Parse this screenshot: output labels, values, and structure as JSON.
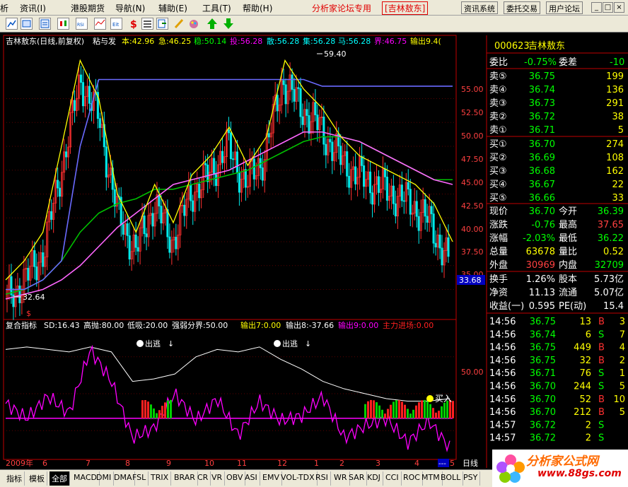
{
  "menu": {
    "items": [
      "析",
      "资讯(I)",
      "港股期货",
      "导航(N)",
      "辅助(E)",
      "工具(T)",
      "帮助(H)"
    ],
    "title": "分析家论坛专用",
    "stock_tag": "[吉林敖东]",
    "buttons": [
      "资讯系统",
      "委托交易",
      "用户论坛"
    ],
    "window_buttons": [
      "_",
      "□",
      "×"
    ]
  },
  "chart_header": {
    "name": "吉林敖东(日线,前复权)",
    "indicator": "粘与发",
    "items": [
      {
        "label": "本:42.96",
        "color": "#ffff00"
      },
      {
        "label": "急:46.25",
        "color": "#ffff00"
      },
      {
        "label": "稳:50.14",
        "color": "#00ff00"
      },
      {
        "label": "投:56.28",
        "color": "#ff00ff"
      },
      {
        "label": "散:56.28",
        "color": "#00ffff"
      },
      {
        "label": "集:56.28",
        "color": "#00ffff"
      },
      {
        "label": "马:56.28",
        "color": "#00ffff"
      },
      {
        "label": "界:46.75",
        "color": "#ff00ff"
      },
      {
        "label": "输出9.4(",
        "color": "#ffff00"
      }
    ]
  },
  "price_axis": {
    "ticks": [
      "55.00",
      "52.50",
      "50.00",
      "47.50",
      "45.00",
      "42.50",
      "40.00",
      "37.50",
      "35.00"
    ],
    "marker": "33.68"
  },
  "annotations": {
    "high": "59.40",
    "low": "32.64",
    "sell": "出逃",
    "buy": "买入",
    "low_mark": "$"
  },
  "sub_header": {
    "name": "复合指标",
    "items": [
      {
        "label": "SD:16.43",
        "color": "#ffffff"
      },
      {
        "label": "高抛:80.00",
        "color": "#ffffff"
      },
      {
        "label": "低吸:20.00",
        "color": "#ffffff"
      },
      {
        "label": "强弱分界:50.00",
        "color": "#ffffff"
      },
      {
        "label": "输出7:0.00",
        "color": "#ffff00"
      },
      {
        "label": "输出8:-37.66",
        "color": "#ffffff"
      },
      {
        "label": "输出9:0.00",
        "color": "#ff00ff"
      },
      {
        "label": "主力进场:0.00",
        "color": "#ff2020"
      }
    ],
    "axis_label": "50.00"
  },
  "date_axis": {
    "labels": [
      "2009年",
      "6",
      "7",
      "8",
      "9",
      "10",
      "11",
      "12",
      "1",
      "2",
      "3",
      "4"
    ],
    "scroll": [
      "---",
      "5"
    ],
    "period": "日线"
  },
  "quote": {
    "code": "000623",
    "name": "吉林敖东",
    "weibi": {
      "label": "委比",
      "value": "-0.75%",
      "label2": "委差",
      "value2": "-10"
    },
    "sells": [
      {
        "label": "卖⑤",
        "price": "36.75",
        "vol": "199"
      },
      {
        "label": "卖④",
        "price": "36.74",
        "vol": "136"
      },
      {
        "label": "卖③",
        "price": "36.73",
        "vol": "291"
      },
      {
        "label": "卖②",
        "price": "36.72",
        "vol": "38"
      },
      {
        "label": "卖①",
        "price": "36.71",
        "vol": "5"
      }
    ],
    "buys": [
      {
        "label": "买①",
        "price": "36.70",
        "vol": "274"
      },
      {
        "label": "买②",
        "price": "36.69",
        "vol": "108"
      },
      {
        "label": "买③",
        "price": "36.68",
        "vol": "162"
      },
      {
        "label": "买④",
        "price": "36.67",
        "vol": "22"
      },
      {
        "label": "买⑤",
        "price": "36.66",
        "vol": "33"
      }
    ],
    "stats": [
      {
        "l1": "现价",
        "v1": "36.70",
        "c1": "#00ff00",
        "l2": "今开",
        "v2": "36.39",
        "c2": "#00ff00"
      },
      {
        "l1": "涨跌",
        "v1": "-0.76",
        "c1": "#00ff00",
        "l2": "最高",
        "v2": "37.65",
        "c2": "#ff4040"
      },
      {
        "l1": "涨幅",
        "v1": "-2.03%",
        "c1": "#00ff00",
        "l2": "最低",
        "v2": "36.22",
        "c2": "#00ff00"
      },
      {
        "l1": "总量",
        "v1": "63678",
        "c1": "#ffff00",
        "l2": "量比",
        "v2": "0.52",
        "c2": "#ffff00"
      },
      {
        "l1": "外盘",
        "v1": "30969",
        "c1": "#ff4040",
        "l2": "内盘",
        "v2": "32709",
        "c2": "#00ff00"
      }
    ],
    "stats2": [
      {
        "l1": "换手",
        "v1": "1.26%",
        "l2": "股本",
        "v2": "5.73亿"
      },
      {
        "l1": "净资",
        "v1": "11.13",
        "l2": "流通",
        "v2": "5.07亿"
      },
      {
        "l1": "收益(一)",
        "v1": "0.595",
        "l2": "PE(动)",
        "v2": "15.4"
      }
    ],
    "ticks": [
      {
        "time": "14:56",
        "price": "36.75",
        "vol": "13",
        "bs": "B"
      },
      {
        "time": "14:56",
        "price": "36.74",
        "vol": "6",
        "bs": "S"
      },
      {
        "time": "14:56",
        "price": "36.75",
        "vol": "449",
        "bs": "B"
      },
      {
        "time": "14:56",
        "price": "36.75",
        "vol": "32",
        "bs": "B"
      },
      {
        "time": "14:56",
        "price": "36.71",
        "vol": "76",
        "bs": "S"
      },
      {
        "time": "14:56",
        "price": "36.70",
        "vol": "244",
        "bs": "S"
      },
      {
        "time": "14:56",
        "price": "36.70",
        "vol": "52",
        "bs": "B"
      },
      {
        "time": "14:56",
        "price": "36.70",
        "vol": "212",
        "bs": "B"
      },
      {
        "time": "14:57",
        "price": "36.72",
        "vol": "2",
        "bs": "S"
      },
      {
        "time": "14:57",
        "price": "36.72",
        "vol": "2",
        "bs": "S"
      }
    ],
    "tick_extra": [
      "3",
      "7",
      "4",
      "2",
      "1",
      "5",
      "10",
      "5",
      "",
      ""
    ]
  },
  "bottom_tabs": [
    "指标",
    "模板",
    "全部",
    "MACD",
    "DMI",
    "DMA",
    "FSL",
    "TRIX",
    "BRAR",
    "CR",
    "VR",
    "OBV",
    "ASI",
    "EMV",
    "VOL-TDX",
    "RSI",
    "WR",
    "SAR",
    "KDJ",
    "CCI",
    "ROC",
    "MTM",
    "BOLL",
    "PSY"
  ],
  "logo": {
    "line1": "分析家公式网",
    "line2": "www.88gs.com"
  },
  "chart_data": [
    {
      "type": "line",
      "x": [
        0,
        10,
        20,
        30,
        40,
        50,
        60,
        70,
        80,
        90,
        100,
        110,
        120,
        130,
        140,
        150,
        160,
        170,
        180,
        190,
        200,
        210,
        220,
        230,
        240
      ],
      "series": [
        {
          "values": [
            34.0,
            36.0,
            39.0,
            48.0,
            57.0,
            53.0,
            43.0,
            39.0,
            44.0,
            40.0,
            45.0,
            47.0,
            50.0,
            46.0,
            49.0,
            57.0,
            54.0,
            52.0,
            49.0,
            47.0,
            46.0,
            45.0,
            44.0,
            42.0,
            38.0
          ]
        },
        {
          "values": [
            34.5,
            35.0,
            36.0,
            38.0,
            41.0,
            43.0,
            44.0,
            44.5,
            45.5,
            45.5,
            46.0,
            46.5,
            47.0,
            47.5,
            48.5,
            49.5,
            50.5,
            51.0,
            51.0,
            50.5,
            49.5,
            48.5,
            47.5,
            46.5,
            46.5
          ]
        },
        {
          "values": [
            34.0,
            34.5,
            35.0,
            36.0,
            37.5,
            39.5,
            41.5,
            43.0,
            44.5,
            46.0,
            46.5,
            47.0,
            47.5,
            48.5,
            49.5,
            50.5,
            51.5,
            51.5,
            51.0,
            50.5,
            49.5,
            48.5,
            47.5,
            46.5,
            46.0
          ]
        },
        {
          "values": [
            35.0,
            35.0,
            36.0,
            38.0,
            50.0,
            57.0,
            57.0,
            57.0,
            57.0,
            57.0,
            57.0,
            57.0,
            57.0,
            57.0,
            57.0,
            57.0,
            57.0,
            56.3,
            56.3,
            56.3,
            56.3,
            56.3,
            56.3,
            56.3,
            56.3
          ]
        }
      ],
      "ylim": [
        32.0,
        60.0
      ]
    },
    {
      "type": "line",
      "series": [
        {
          "values": [
            86,
            88,
            86,
            84,
            88,
            84,
            60,
            62,
            66,
            80,
            86,
            84,
            88,
            78,
            70,
            60,
            54,
            50,
            46,
            44,
            44,
            46
          ]
        },
        {
          "values": [
            42,
            30,
            48,
            34,
            86,
            60,
            14,
            22,
            50,
            28,
            46,
            16,
            44,
            28,
            32,
            48,
            14,
            24,
            30,
            10,
            28,
            6
          ]
        }
      ],
      "ylim": [
        0,
        100
      ]
    }
  ]
}
